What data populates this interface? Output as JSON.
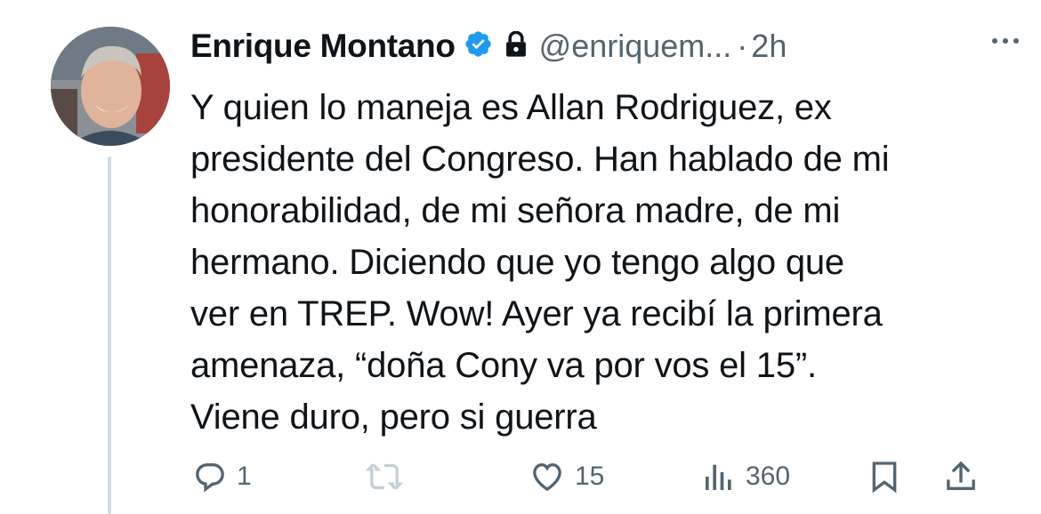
{
  "tweet": {
    "author_name": "Enrique Montano",
    "handle": "@enriquem...",
    "separator": "·",
    "time": "2h",
    "text": "Y quien lo maneja es Allan Rodriguez, ex\npresidente del Congreso. Han hablado de mi\nhonorabilidad, de mi señora madre, de mi\nhermano. Diciendo que yo tengo algo que\nver en TREP. Wow! Ayer ya recibí la primera\namenaza, “doña Cony va por vos el 15”.\nViene duro, pero si guerra"
  },
  "actions": {
    "reply_count": "1",
    "like_count": "15",
    "views_count": "360"
  },
  "colors": {
    "text": "#0f1419",
    "muted": "#536471",
    "verified": "#1d9bf0",
    "thread_line": "#cfd9de",
    "retweet_disabled": "#c4cfd6"
  },
  "icons": [
    "verified-badge-icon",
    "lock-icon",
    "more-icon",
    "reply-icon",
    "retweet-icon",
    "like-icon",
    "views-icon",
    "bookmark-icon",
    "share-icon"
  ]
}
